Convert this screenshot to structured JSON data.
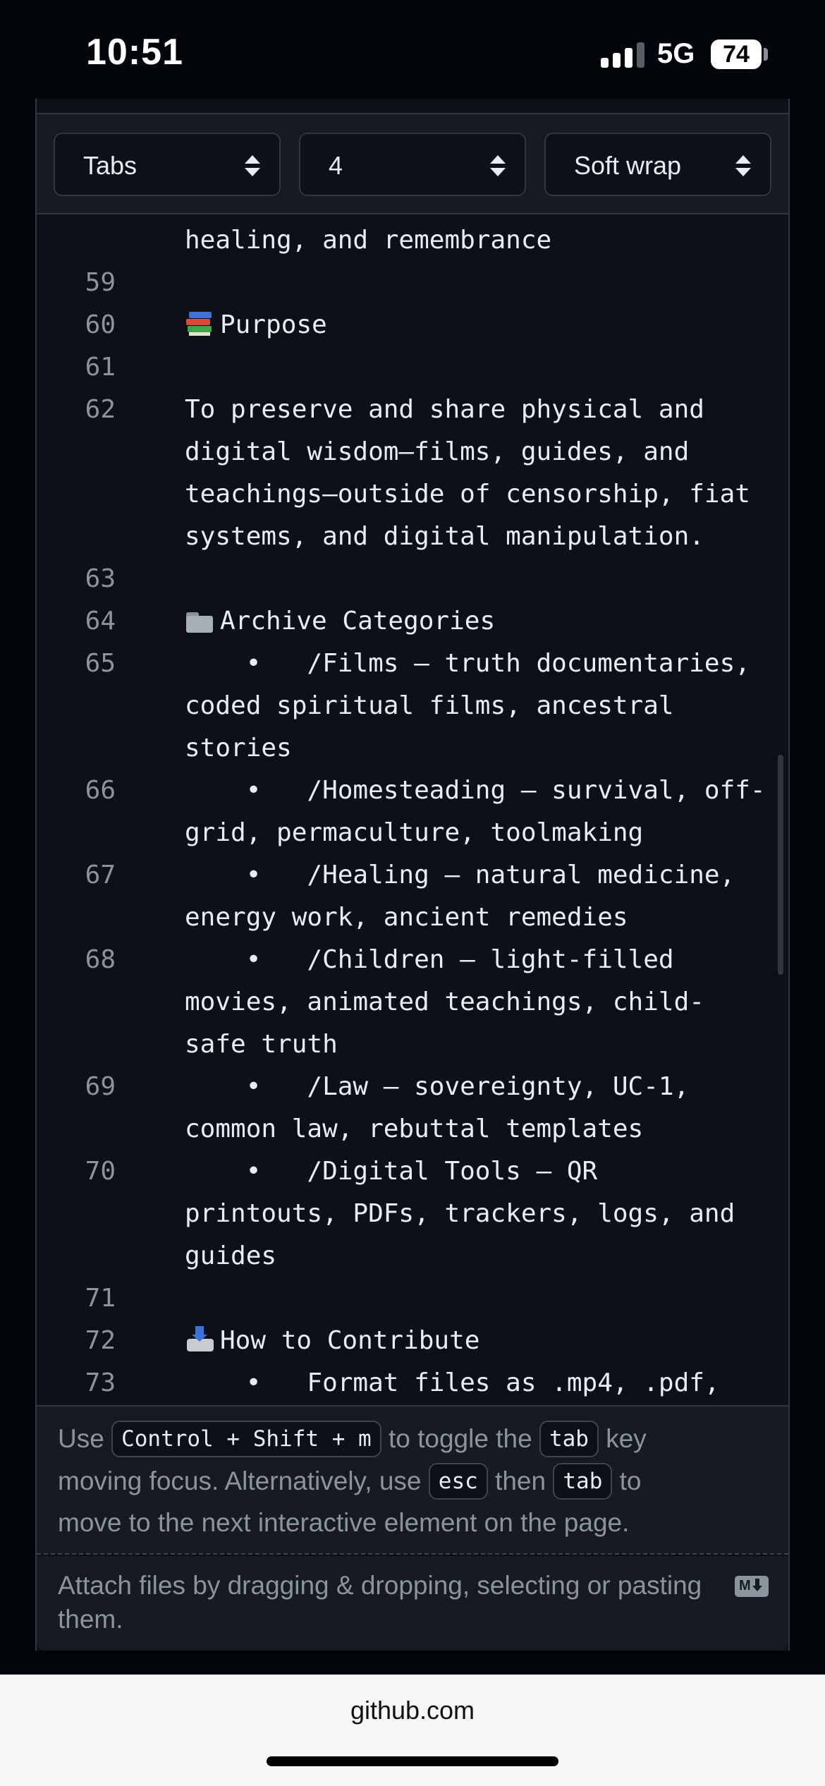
{
  "status_bar": {
    "time": "10:51",
    "network": "5G",
    "battery": "74"
  },
  "toolbar": {
    "indent_mode": "Tabs",
    "indent_size": "4",
    "wrap_mode": "Soft wrap"
  },
  "code_lines": [
    {
      "num": "",
      "text": "healing, and remembrance"
    },
    {
      "num": "59",
      "text": ""
    },
    {
      "num": "60",
      "icon": "books-emoji",
      "text": "Purpose"
    },
    {
      "num": "61",
      "text": ""
    },
    {
      "num": "62",
      "text": "To preserve and share physical and"
    },
    {
      "num": "",
      "text": "digital wisdom—films, guides, and"
    },
    {
      "num": "",
      "text": "teachings—outside of censorship, fiat"
    },
    {
      "num": "",
      "text": "systems, and digital manipulation."
    },
    {
      "num": "63",
      "text": ""
    },
    {
      "num": "64",
      "icon": "folder-emoji",
      "text": "Archive Categories"
    },
    {
      "num": "65",
      "text": "    •   /Films — truth documentaries,"
    },
    {
      "num": "",
      "text": "coded spiritual films, ancestral"
    },
    {
      "num": "",
      "text": "stories"
    },
    {
      "num": "66",
      "text": "    •   /Homesteading — survival, off-"
    },
    {
      "num": "",
      "text": "grid, permaculture, toolmaking"
    },
    {
      "num": "67",
      "text": "    •   /Healing — natural medicine,"
    },
    {
      "num": "",
      "text": "energy work, ancient remedies"
    },
    {
      "num": "68",
      "text": "    •   /Children — light-filled"
    },
    {
      "num": "",
      "text": "movies, animated teachings, child-"
    },
    {
      "num": "",
      "text": "safe truth"
    },
    {
      "num": "69",
      "text": "    •   /Law — sovereignty, UC-1,"
    },
    {
      "num": "",
      "text": "common law, rebuttal templates"
    },
    {
      "num": "70",
      "text": "    •   /Digital Tools — QR"
    },
    {
      "num": "",
      "text": "printouts, PDFs, trackers, logs, and"
    },
    {
      "num": "",
      "text": "guides"
    },
    {
      "num": "71",
      "text": ""
    },
    {
      "num": "72",
      "icon": "outbox-tray-emoji",
      "text": "How to Contribute"
    },
    {
      "num": "73",
      "text": "    •   Format files as .mp4, .pdf,"
    }
  ],
  "hint": {
    "use": "Use",
    "shortcut": "Control + Shift + m",
    "to_toggle_the": "to toggle the",
    "tab_key": "tab",
    "key": "key",
    "moving_focus": "moving focus. Alternatively, use",
    "esc_key": "esc",
    "then": "then",
    "tab_key_2": "tab",
    "to": "to",
    "move_next": "move to the next interactive element on the page."
  },
  "attach": {
    "text": "Attach files by dragging & dropping, selecting or pasting them.",
    "icon": "markdown-icon"
  },
  "browser": {
    "url": "github.com"
  }
}
